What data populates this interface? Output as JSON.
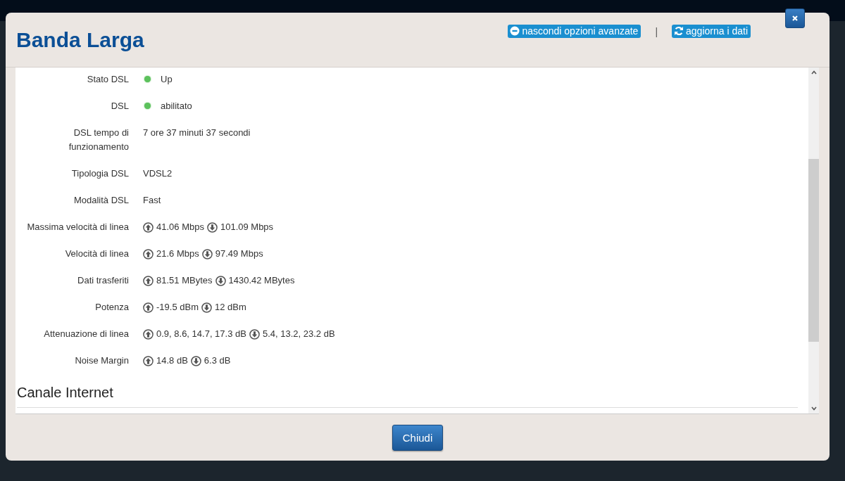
{
  "dialog": {
    "title": "Banda Larga",
    "links": [
      {
        "label": "nascondi opzioni avanzate",
        "kind": "hide"
      },
      {
        "label": "aggiorna i dati",
        "kind": "refresh"
      }
    ],
    "separator": "|"
  },
  "rows": [
    {
      "label": "Stato DSL",
      "kind": "status",
      "value": "Up",
      "color": "#5cc15c"
    },
    {
      "label": "DSL",
      "kind": "status",
      "value": "abilitato",
      "color": "#5cc15c"
    },
    {
      "label": "DSL tempo di funzionamento",
      "kind": "text",
      "value": "7 ore 37 minuti 37 secondi"
    },
    {
      "label": "Tipologia DSL",
      "kind": "text",
      "value": "VDSL2"
    },
    {
      "label": "Modalità DSL",
      "kind": "text",
      "value": "Fast"
    },
    {
      "label": "Massima velocità di linea",
      "kind": "updown",
      "up": "41.06 Mbps",
      "down": "101.09 Mbps"
    },
    {
      "label": "Velocità di linea",
      "kind": "updown",
      "up": "21.6 Mbps",
      "down": "97.49 Mbps"
    },
    {
      "label": "Dati trasferiti",
      "kind": "updown",
      "up": "81.51 MBytes",
      "down": "1430.42 MBytes"
    },
    {
      "label": "Potenza",
      "kind": "updown",
      "up": "-19.5 dBm",
      "down": "12 dBm"
    },
    {
      "label": "Attenuazione di linea",
      "kind": "updown",
      "up": "0.9, 8.6, 14.7, 17.3 dB",
      "down": "5.4, 13.2, 23.2 dB"
    },
    {
      "label": "Noise Margin",
      "kind": "updown",
      "up": "14.8 dB",
      "down": "6.3 dB"
    }
  ],
  "section_heading": "Canale Internet",
  "footer": {
    "button": "Chiudi"
  }
}
